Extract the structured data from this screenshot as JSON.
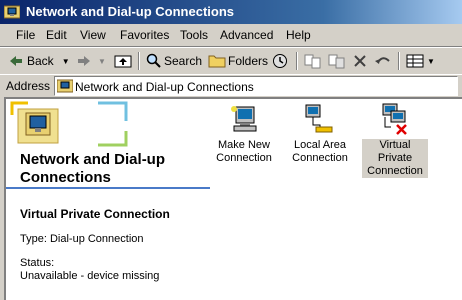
{
  "window": {
    "title": "Network and Dial-up Connections"
  },
  "menu": [
    "File",
    "Edit",
    "View",
    "Favorites",
    "Tools",
    "Advanced",
    "Help"
  ],
  "toolbar": {
    "back_label": "Back",
    "search_label": "Search",
    "folders_label": "Folders"
  },
  "address": {
    "label": "Address",
    "value": "Network and Dial-up Connections"
  },
  "content": {
    "heading": "Network and Dial-up Connections",
    "detail": {
      "name": "Virtual Private Connection",
      "type": "Type: Dial-up Connection",
      "status_label": "Status:",
      "status_value": "Unavailable - device missing"
    },
    "items": [
      {
        "label": "Make New Connection",
        "icon": "make-new-connection-icon"
      },
      {
        "label": "Local Area Connection",
        "icon": "local-area-connection-icon"
      },
      {
        "label": "Virtual Private Connection",
        "icon": "virtual-private-connection-icon",
        "selected": true
      }
    ]
  }
}
